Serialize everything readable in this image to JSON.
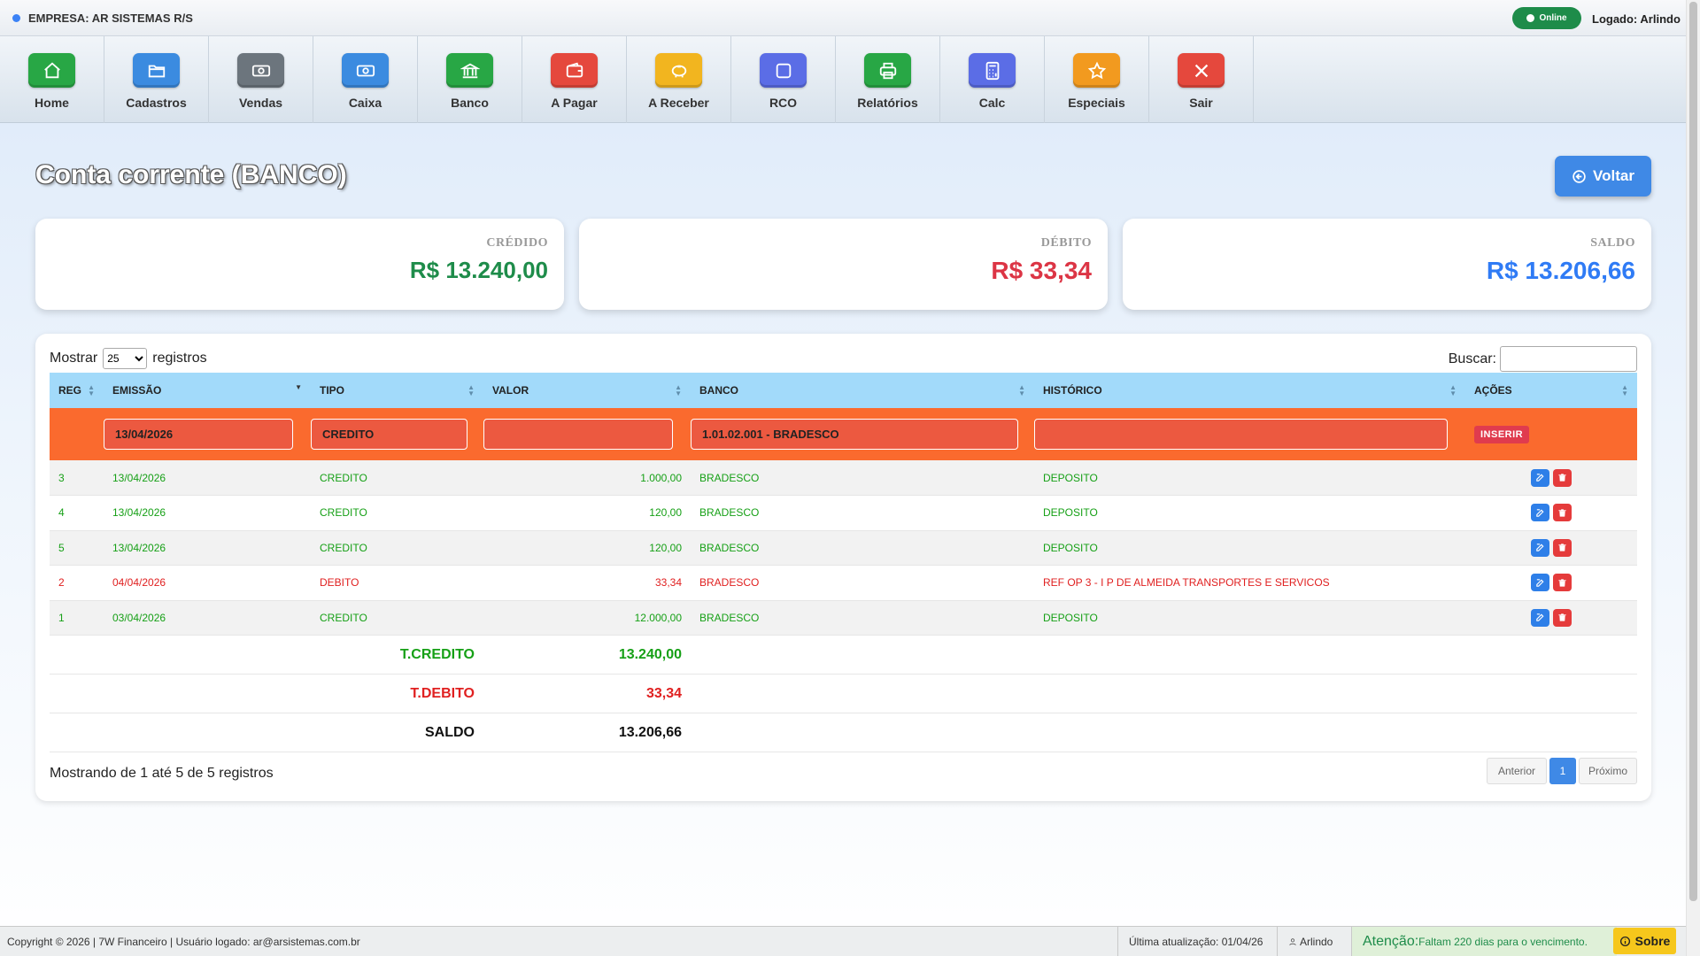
{
  "header": {
    "empresa": "EMPRESA: AR SISTEMAS R/S",
    "status": "Online",
    "logado": "Logado: Arlindo"
  },
  "nav": [
    {
      "label": "Home",
      "icon": "home-icon",
      "color": "#28a745"
    },
    {
      "label": "Cadastros",
      "icon": "folder-icon",
      "color": "#3b8be0"
    },
    {
      "label": "Vendas",
      "icon": "cash-icon",
      "color": "#6c757d"
    },
    {
      "label": "Caixa",
      "icon": "cash-icon",
      "color": "#3b8be0"
    },
    {
      "label": "Banco",
      "icon": "bank-icon",
      "color": "#28a745"
    },
    {
      "label": "A Pagar",
      "icon": "wallet-icon",
      "color": "#e5483d"
    },
    {
      "label": "A Receber",
      "icon": "piggy-bank-icon",
      "color": "#f2b51f"
    },
    {
      "label": "RCO",
      "icon": "square-icon",
      "color": "#5b6de6"
    },
    {
      "label": "Relatórios",
      "icon": "printer-icon",
      "color": "#28a745"
    },
    {
      "label": "Calc",
      "icon": "calculator-icon",
      "color": "#5b6de6"
    },
    {
      "label": "Especiais",
      "icon": "star-icon",
      "color": "#f29a1f"
    },
    {
      "label": "Sair",
      "icon": "close-icon",
      "color": "#e5483d"
    }
  ],
  "page": {
    "title": "Conta corrente (BANCO)",
    "back_label": "Voltar"
  },
  "summary": {
    "credito": {
      "label": "CRÉDIDO",
      "value": "R$ 13.240,00",
      "color": "#1e8c4a"
    },
    "debito": {
      "label": "DÉBITO",
      "value": "R$ 33,34",
      "color": "#dc3545"
    },
    "saldo": {
      "label": "SALDO",
      "value": "R$ 13.206,66",
      "color": "#2f7bf5"
    }
  },
  "table": {
    "length_prefix": "Mostrar",
    "length_value": "25",
    "length_suffix": "registros",
    "search_label": "Buscar:",
    "search_value": "",
    "columns": [
      "REG",
      "EMISSÃO",
      "TIPO",
      "VALOR",
      "BANCO",
      "HISTÓRICO",
      "AÇÕES"
    ],
    "insert_row": {
      "emissao": "13/04/2026",
      "tipo": "CREDITO",
      "valor": "",
      "banco": "1.01.02.001 - BRADESCO",
      "historico": "",
      "button": "INSERIR"
    },
    "rows": [
      {
        "reg": "3",
        "emissao": "13/04/2026",
        "tipo": "CREDITO",
        "valor": "1.000,00",
        "banco": "BRADESCO",
        "historico": "DEPOSITO"
      },
      {
        "reg": "4",
        "emissao": "13/04/2026",
        "tipo": "CREDITO",
        "valor": "120,00",
        "banco": "BRADESCO",
        "historico": "DEPOSITO"
      },
      {
        "reg": "5",
        "emissao": "13/04/2026",
        "tipo": "CREDITO",
        "valor": "120,00",
        "banco": "BRADESCO",
        "historico": "DEPOSITO"
      },
      {
        "reg": "2",
        "emissao": "04/04/2026",
        "tipo": "DEBITO",
        "valor": "33,34",
        "banco": "BRADESCO",
        "historico": "REF OP 3 - I P DE ALMEIDA TRANSPORTES E SERVICOS"
      },
      {
        "reg": "1",
        "emissao": "03/04/2026",
        "tipo": "CREDITO",
        "valor": "12.000,00",
        "banco": "BRADESCO",
        "historico": "DEPOSITO"
      }
    ],
    "totals": [
      {
        "label": "T.CREDITO",
        "value": "13.240,00",
        "color": "#16a016"
      },
      {
        "label": "T.DEBITO",
        "value": "33,34",
        "color": "#e02020"
      },
      {
        "label": "SALDO",
        "value": "13.206,66",
        "color": "#111111"
      }
    ],
    "info": "Mostrando de 1 até 5 de 5 registros",
    "pagination": {
      "prev": "Anterior",
      "current": "1",
      "next": "Próximo"
    }
  },
  "footer": {
    "copyright": "Copyright © 2026 | 7W Financeiro | Usuário logado: ar@arsistemas.com.br",
    "update": "Última atualização: 01/04/26",
    "user": "Arlindo",
    "attention_label": "Atenção:",
    "attention_text": "Faltam 220 dias para o vencimento.",
    "about": "Sobre"
  }
}
